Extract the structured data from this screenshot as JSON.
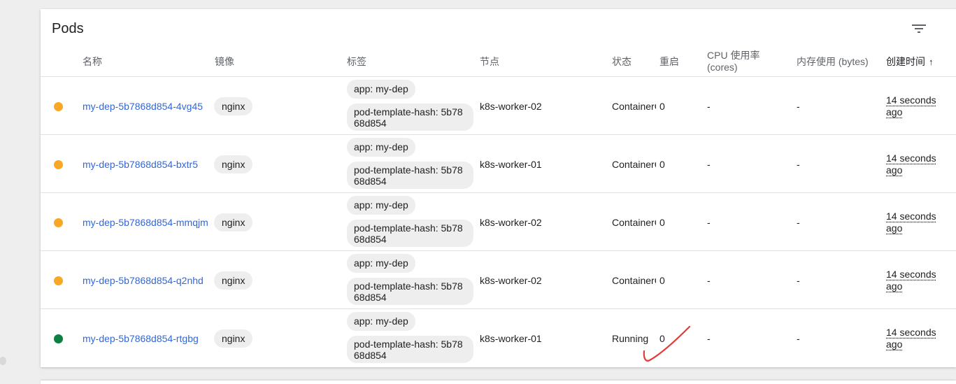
{
  "card": {
    "title": "Pods"
  },
  "columns": {
    "name": "名称",
    "image": "镜像",
    "labels": "标签",
    "node": "节点",
    "status": "状态",
    "restarts": "重启",
    "cpu_line1": "CPU 使用率",
    "cpu_line2": "(cores)",
    "memory": "内存使用 (bytes)",
    "created": "创建时间",
    "created_sort_icon": "arrow-upward-icon"
  },
  "icons": {
    "filter": "filter-list-icon"
  },
  "colors": {
    "pending": "#f9a825",
    "running": "#0b8043",
    "link": "#3367d6",
    "annotation": "#e53935"
  },
  "rows": [
    {
      "status_color": "#f9a825",
      "name": "my-dep-5b7868d854-4vg45",
      "image": "nginx",
      "label1": "app: my-dep",
      "label2": "pod-template-hash: 5b7868d854",
      "node": "k8s-worker-02",
      "state": "ContainerCreating",
      "restarts": "0",
      "cpu": "-",
      "memory": "-",
      "created": "14 seconds ago"
    },
    {
      "status_color": "#f9a825",
      "name": "my-dep-5b7868d854-bxtr5",
      "image": "nginx",
      "label1": "app: my-dep",
      "label2": "pod-template-hash: 5b7868d854",
      "node": "k8s-worker-01",
      "state": "ContainerCreating",
      "restarts": "0",
      "cpu": "-",
      "memory": "-",
      "created": "14 seconds ago"
    },
    {
      "status_color": "#f9a825",
      "name": "my-dep-5b7868d854-mmqjm",
      "image": "nginx",
      "label1": "app: my-dep",
      "label2": "pod-template-hash: 5b7868d854",
      "node": "k8s-worker-02",
      "state": "ContainerCreating",
      "restarts": "0",
      "cpu": "-",
      "memory": "-",
      "created": "14 seconds ago"
    },
    {
      "status_color": "#f9a825",
      "name": "my-dep-5b7868d854-q2nhd",
      "image": "nginx",
      "label1": "app: my-dep",
      "label2": "pod-template-hash: 5b7868d854",
      "node": "k8s-worker-02",
      "state": "ContainerCreating",
      "restarts": "0",
      "cpu": "-",
      "memory": "-",
      "created": "14 seconds ago"
    },
    {
      "status_color": "#0b8043",
      "name": "my-dep-5b7868d854-rtgbg",
      "image": "nginx",
      "label1": "app: my-dep",
      "label2": "pod-template-hash: 5b7868d854",
      "node": "k8s-worker-01",
      "state": "Running",
      "restarts": "0",
      "cpu": "-",
      "memory": "-",
      "created": "14 seconds ago"
    }
  ]
}
